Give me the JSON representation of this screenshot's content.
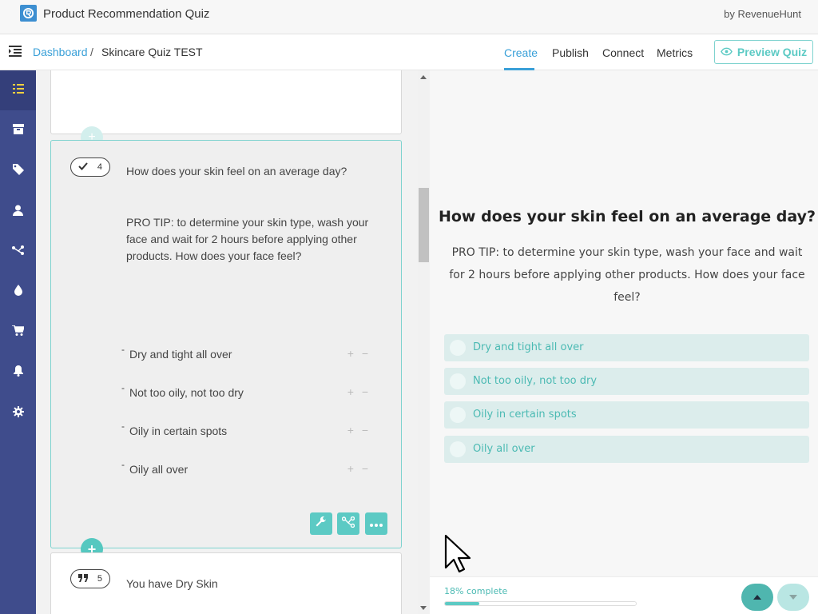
{
  "app": {
    "title": "Product Recommendation Quiz",
    "byline": "by RevenueHunt",
    "logo": "revenuehunt-logo"
  },
  "breadcrumb": {
    "root": "Dashboard",
    "separator": "/",
    "current": "Skincare Quiz TEST"
  },
  "tabs": [
    {
      "label": "Create",
      "active": true
    },
    {
      "label": "Publish",
      "active": false
    },
    {
      "label": "Connect",
      "active": false
    },
    {
      "label": "Metrics",
      "active": false
    }
  ],
  "preview_button": {
    "label": "Preview Quiz",
    "icon": "eye-icon"
  },
  "sidebar": {
    "items": [
      {
        "icon": "grid-icon",
        "active": true
      },
      {
        "icon": "box-icon",
        "active": false
      },
      {
        "icon": "tag-icon",
        "active": false
      },
      {
        "icon": "user-icon",
        "active": false
      },
      {
        "icon": "share-nodes-icon",
        "active": false
      },
      {
        "icon": "drop-icon",
        "active": false
      },
      {
        "icon": "cart-icon",
        "active": false
      },
      {
        "icon": "bell-icon",
        "active": false
      },
      {
        "icon": "gear-icon",
        "active": false
      }
    ]
  },
  "editor": {
    "active_question": {
      "number": "4",
      "icon": "check-icon",
      "title": "How does your skin feel on an average day?",
      "description": "PRO TIP: to determine your skin type, wash your face and wait for 2 hours before applying other products. How does your face feel?",
      "answers": [
        {
          "label": "Dry and tight all over",
          "dash": "-"
        },
        {
          "label": "Not too oily, not too dry",
          "dash": "-"
        },
        {
          "label": "Oily in certain spots",
          "dash": "-"
        },
        {
          "label": "Oily all over",
          "dash": "-"
        }
      ],
      "answer_controls": "+ −",
      "tools": [
        "wrench-icon",
        "branch-icon",
        "more-icon"
      ]
    },
    "add_symbol": "+",
    "next_question": {
      "number": "5",
      "icon": "quote-icon",
      "title": "You have Dry Skin"
    }
  },
  "preview": {
    "title": "How does your skin feel on an average day?",
    "description": "PRO TIP: to determine your skin type, wash your face and wait for 2 hours before applying other products. How does your face feel?",
    "options": [
      {
        "label": "Dry and tight all over"
      },
      {
        "label": "Not too oily, not too dry"
      },
      {
        "label": "Oily in certain spots"
      },
      {
        "label": "Oily all over"
      }
    ],
    "progress": {
      "text": "18% complete",
      "value": 0.18
    }
  },
  "colors": {
    "accent": "#5ccac4",
    "link": "#3aa0d8",
    "sidebar": "#3f4c8c",
    "option_bg": "#dcedec"
  }
}
